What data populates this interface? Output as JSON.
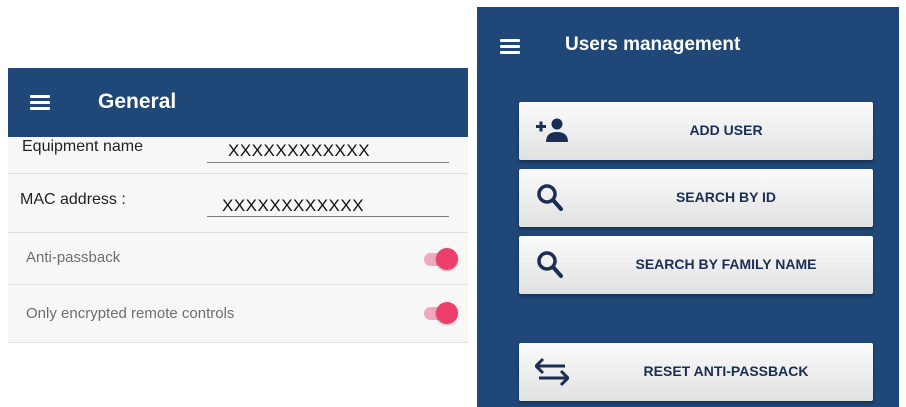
{
  "general": {
    "title": "General",
    "fields": [
      {
        "label": "Equipment name",
        "value": "XXXXXXXXXXXX"
      },
      {
        "label": "MAC address :",
        "value": "XXXXXXXXXXXX"
      }
    ],
    "toggles": [
      {
        "label": "Anti-passback",
        "on": true
      },
      {
        "label": "Only encrypted remote controls",
        "on": true
      }
    ]
  },
  "users": {
    "title": "Users management",
    "buttons": [
      {
        "label": "ADD USER",
        "icon": "add-user-icon"
      },
      {
        "label": "SEARCH BY ID",
        "icon": "search-icon"
      },
      {
        "label": "SEARCH BY FAMILY NAME",
        "icon": "search-icon"
      },
      {
        "label": "RESET ANTI-PASSBACK",
        "icon": "swap-arrows-icon"
      }
    ]
  },
  "colors": {
    "appbar": "#1f4778",
    "toggle_accent": "#ec3f6d"
  }
}
